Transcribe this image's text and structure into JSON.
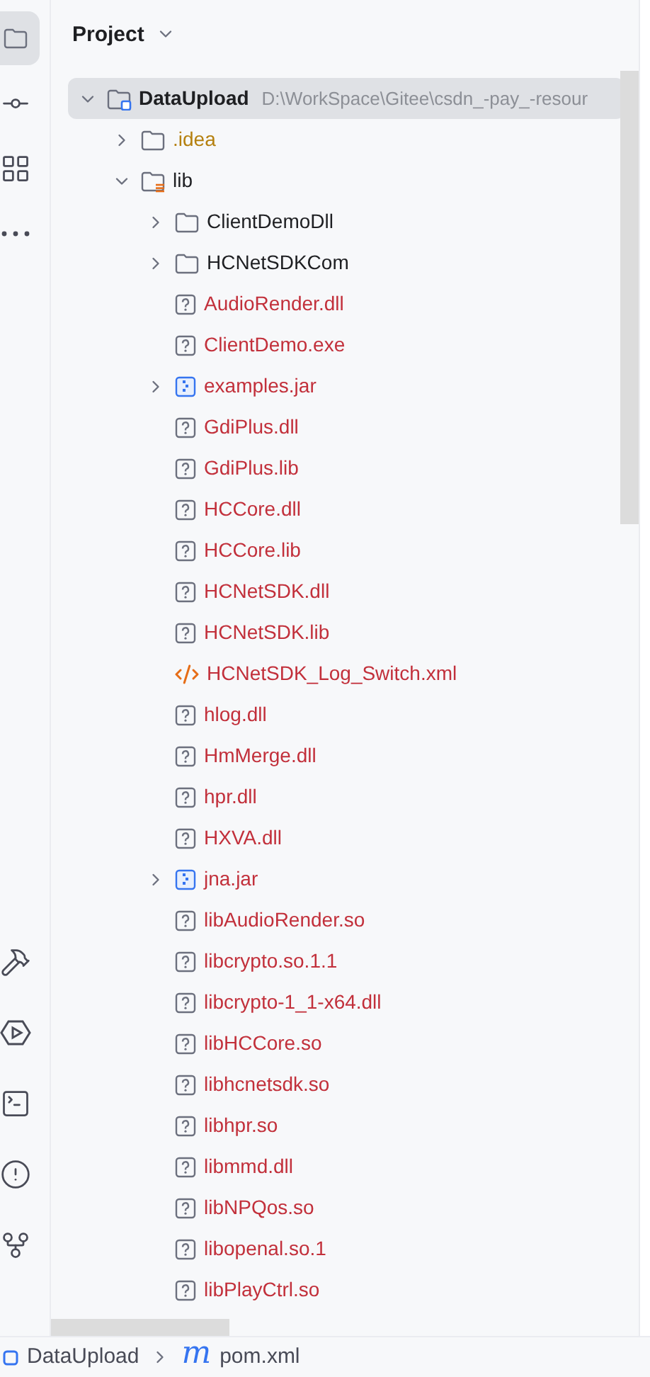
{
  "toolbar": [
    {
      "kind": "folder",
      "selected": true
    },
    {
      "kind": "commit",
      "selected": false
    },
    {
      "kind": "structure",
      "selected": false
    },
    {
      "kind": "more",
      "selected": false
    }
  ],
  "toolbar_bottom": [
    {
      "kind": "hammer",
      "selected": false
    },
    {
      "kind": "run",
      "selected": false
    },
    {
      "kind": "terminal",
      "selected": false
    },
    {
      "kind": "problems",
      "selected": false
    },
    {
      "kind": "git",
      "selected": false
    }
  ],
  "panel": {
    "title": "Project"
  },
  "tree": [
    {
      "kind": "module",
      "name": "DataUpload",
      "path": "D:\\WorkSpace\\Gitee\\csdn_-pay_-resour",
      "expanded": true,
      "selected": true,
      "color": "#1e1f22",
      "children": [
        {
          "kind": "folder",
          "name": ".idea",
          "expanded": false,
          "selected": false,
          "color": "#b5800f"
        },
        {
          "kind": "library",
          "name": "lib",
          "expanded": true,
          "selected": false,
          "color": "#1e1f22",
          "children": [
            {
              "kind": "folder",
              "name": "ClientDemoDll",
              "expanded": false,
              "selected": false,
              "color": "#1e1f22"
            },
            {
              "kind": "folder",
              "name": "HCNetSDKCom",
              "expanded": false,
              "selected": false,
              "color": "#1e1f22"
            },
            {
              "kind": "unknown",
              "name": "AudioRender.dll",
              "selected": false,
              "color": "#c2303b"
            },
            {
              "kind": "unknown",
              "name": "ClientDemo.exe",
              "selected": false,
              "color": "#c2303b"
            },
            {
              "kind": "jar",
              "name": "examples.jar",
              "expanded": false,
              "selected": false,
              "color": "#c2303b"
            },
            {
              "kind": "unknown",
              "name": "GdiPlus.dll",
              "selected": false,
              "color": "#c2303b"
            },
            {
              "kind": "unknown",
              "name": "GdiPlus.lib",
              "selected": false,
              "color": "#c2303b"
            },
            {
              "kind": "unknown",
              "name": "HCCore.dll",
              "selected": false,
              "color": "#c2303b"
            },
            {
              "kind": "unknown",
              "name": "HCCore.lib",
              "selected": false,
              "color": "#c2303b"
            },
            {
              "kind": "unknown",
              "name": "HCNetSDK.dll",
              "selected": false,
              "color": "#c2303b"
            },
            {
              "kind": "unknown",
              "name": "HCNetSDK.lib",
              "selected": false,
              "color": "#c2303b"
            },
            {
              "kind": "xml",
              "name": "HCNetSDK_Log_Switch.xml",
              "selected": false,
              "color": "#c2303b"
            },
            {
              "kind": "unknown",
              "name": "hlog.dll",
              "selected": false,
              "color": "#c2303b"
            },
            {
              "kind": "unknown",
              "name": "HmMerge.dll",
              "selected": false,
              "color": "#c2303b"
            },
            {
              "kind": "unknown",
              "name": "hpr.dll",
              "selected": false,
              "color": "#c2303b"
            },
            {
              "kind": "unknown",
              "name": "HXVA.dll",
              "selected": false,
              "color": "#c2303b"
            },
            {
              "kind": "jar",
              "name": "jna.jar",
              "expanded": false,
              "selected": false,
              "color": "#c2303b"
            },
            {
              "kind": "unknown",
              "name": "libAudioRender.so",
              "selected": false,
              "color": "#c2303b"
            },
            {
              "kind": "unknown",
              "name": "libcrypto.so.1.1",
              "selected": false,
              "color": "#c2303b"
            },
            {
              "kind": "unknown",
              "name": "libcrypto-1_1-x64.dll",
              "selected": false,
              "color": "#c2303b"
            },
            {
              "kind": "unknown",
              "name": "libHCCore.so",
              "selected": false,
              "color": "#c2303b"
            },
            {
              "kind": "unknown",
              "name": "libhcnetsdk.so",
              "selected": false,
              "color": "#c2303b"
            },
            {
              "kind": "unknown",
              "name": "libhpr.so",
              "selected": false,
              "color": "#c2303b"
            },
            {
              "kind": "unknown",
              "name": "libmmd.dll",
              "selected": false,
              "color": "#c2303b"
            },
            {
              "kind": "unknown",
              "name": "libNPQos.so",
              "selected": false,
              "color": "#c2303b"
            },
            {
              "kind": "unknown",
              "name": "libopenal.so.1",
              "selected": false,
              "color": "#c2303b"
            },
            {
              "kind": "unknown",
              "name": "libPlayCtrl.so",
              "selected": false,
              "color": "#c2303b"
            }
          ]
        }
      ]
    }
  ],
  "status_bar": {
    "crumbs": [
      {
        "kind": "module",
        "label": "DataUpload"
      },
      {
        "kind": "maven",
        "icon_text": "m",
        "label": "pom.xml"
      }
    ]
  }
}
